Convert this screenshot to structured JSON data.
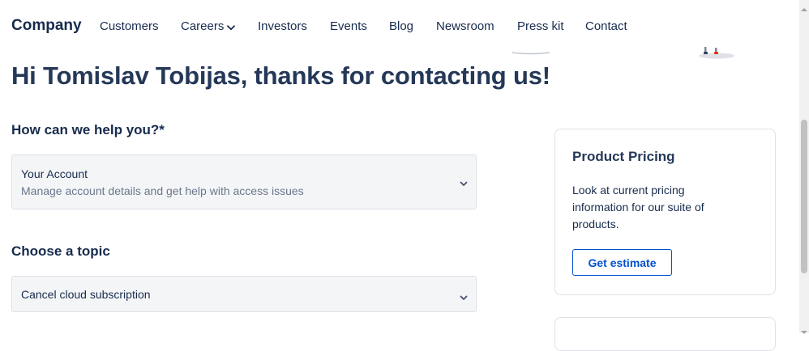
{
  "nav": {
    "brand": "Company",
    "items": [
      {
        "label": "Customers"
      },
      {
        "label": "Careers",
        "has_dropdown": true
      },
      {
        "label": "Investors"
      },
      {
        "label": "Events"
      },
      {
        "label": "Blog"
      },
      {
        "label": "Newsroom"
      },
      {
        "label": "Press kit"
      },
      {
        "label": "Contact"
      }
    ]
  },
  "page": {
    "greeting": "Hi Tomislav Tobijas, thanks for contacting us!"
  },
  "form": {
    "help_label": "How can we help you?*",
    "help_select": {
      "value": "Your Account",
      "description": "Manage account details and get help with access issues"
    },
    "topic_label": "Choose a topic",
    "topic_select": {
      "value": "Cancel cloud subscription"
    }
  },
  "sidebar": {
    "pricing_card": {
      "title": "Product Pricing",
      "text": "Look at current pricing information for our suite of products.",
      "button": "Get estimate"
    }
  },
  "colors": {
    "text_primary": "#172b4d",
    "heading": "#253858",
    "link_blue": "#0052cc",
    "field_bg": "#f4f5f7",
    "border": "#dfe1e6"
  },
  "icons": {
    "dropdown": "chevron-down-icon"
  }
}
